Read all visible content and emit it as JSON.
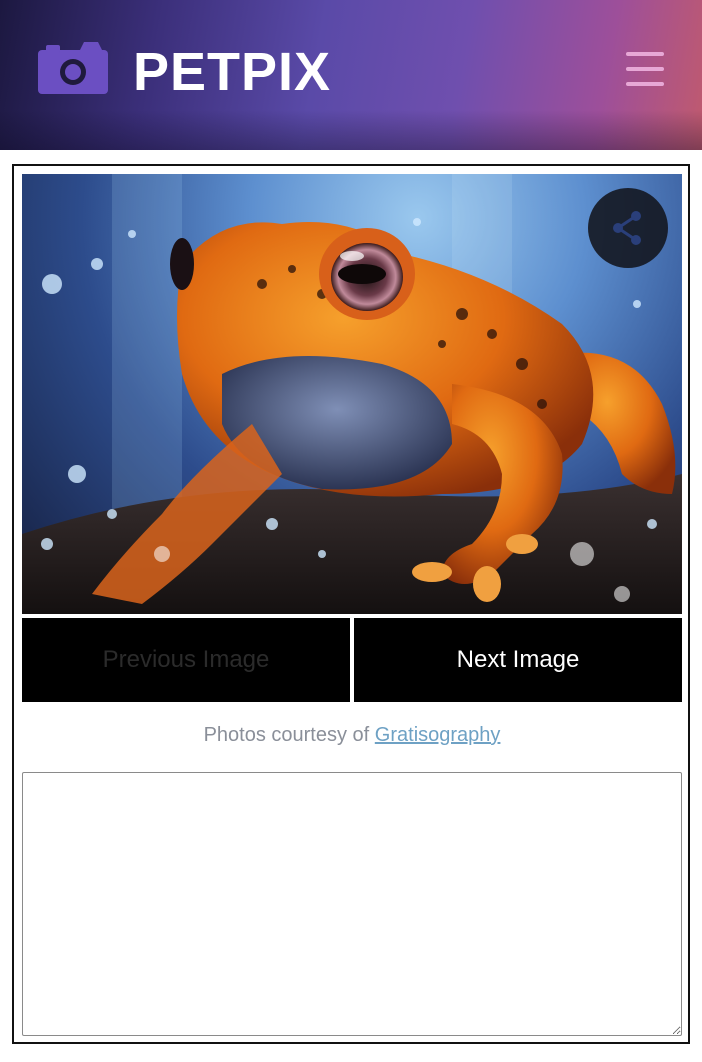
{
  "header": {
    "brand": "PETPIX",
    "logo_icon": "camera-icon",
    "menu_icon": "hamburger-menu-icon"
  },
  "viewer": {
    "share_icon": "share-icon",
    "prev_label": "Previous Image",
    "next_label": "Next Image"
  },
  "credit": {
    "prefix": "Photos courtesy of",
    "link_text": "Gratisography"
  },
  "notes": {
    "value": "",
    "placeholder": ""
  },
  "colors": {
    "header_start": "#1c1840",
    "header_end": "#c05a6e",
    "logo_purple": "#6b4fc2",
    "menu_pink": "#e7a8d6",
    "button_bg": "#000000",
    "link": "#6ea1c4"
  }
}
